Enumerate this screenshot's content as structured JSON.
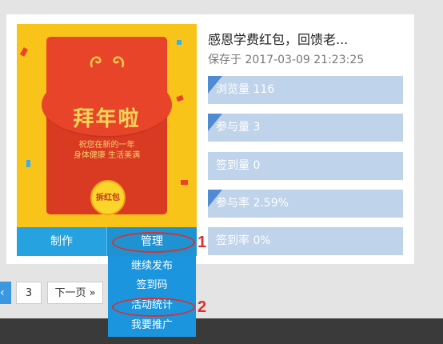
{
  "poster": {
    "title": "拜年啦",
    "line1": "祝您在新的一年",
    "line2": "身体健康 生活美满",
    "coin_label": "拆红包"
  },
  "buttons": {
    "make": "制作",
    "manage": "管理"
  },
  "dropdown": {
    "items": [
      "继续发布",
      "签到码",
      "活动统计",
      "我要推广"
    ]
  },
  "annotations": [
    "1",
    "2"
  ],
  "info": {
    "title": "感恩学费红包，回馈老...",
    "saved": "保存于 2017-03-09 21:23:25"
  },
  "stats": [
    {
      "label": "浏览量 116"
    },
    {
      "label": "参与量 3"
    },
    {
      "label": "签到量 0"
    },
    {
      "label": "参与率 2.59%"
    },
    {
      "label": "签到率 0%"
    }
  ],
  "pagination": {
    "prev": "‹",
    "current": "3",
    "next": "下一页 »"
  },
  "colors": {
    "accent": "#26a2e0",
    "stat_bar": "#bfd3ea",
    "stat_marker": "#4f8bd2",
    "annotation": "#d93030",
    "poster_bg": "#f8c41a",
    "envelope": "#e8442a"
  }
}
